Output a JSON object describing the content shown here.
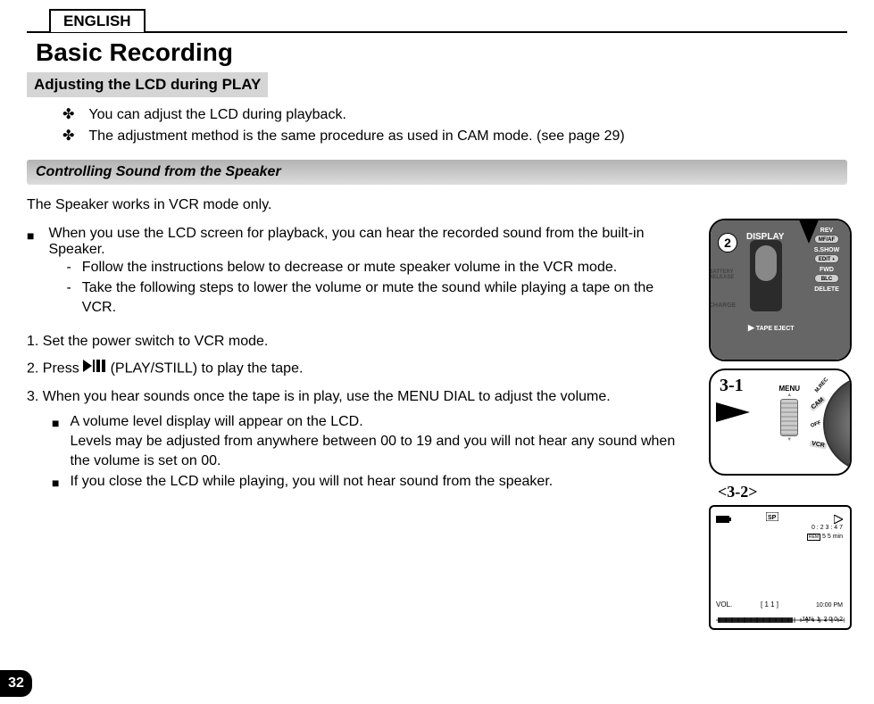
{
  "header": {
    "language_tab": "ENGLISH",
    "title": "Basic Recording"
  },
  "section1": {
    "title": "Adjusting the LCD during PLAY",
    "bullets": [
      "You can adjust the LCD during playback.",
      "The adjustment method is the same procedure as used in CAM mode. (see page 29)"
    ]
  },
  "section2": {
    "title": "Controlling Sound from the Speaker",
    "intro": "The Speaker works in VCR mode only.",
    "para_main": "When you use the LCD screen for playback, you can hear the recorded sound from the built-in Speaker.",
    "dash1": "Follow the instructions below to decrease or mute speaker volume in the VCR mode.",
    "dash2": "Take the following steps to lower the volume or mute the sound while playing a tape on the VCR.",
    "step1": "1.  Set the power switch to VCR mode.",
    "step2_prefix": "2.  Press ",
    "step2_suffix": "(PLAY/STILL) to play the tape.",
    "step3": "3.  When you hear sounds once the tape is in play, use the MENU DIAL to adjust the volume.",
    "nested1a": "A volume level display will appear on the LCD.",
    "nested1b": "Levels may be adjusted from anywhere between 00 to 19 and you will not hear any sound when the volume is set on 00.",
    "nested2": "If you close the LCD while playing, you will not hear sound from the speaker."
  },
  "diagram": {
    "step2_label": "2",
    "step31_label": "3-1",
    "step32_label": "<3-2>",
    "panel1": {
      "display": "DISPLAY",
      "battery_release": "BATTERY RELEASE",
      "charge": "CHARGE",
      "tape_eject": "TAPE EJECT",
      "rev": "REV",
      "mfaf": "MF/AF",
      "sshow": "S.SHOW",
      "edit": "EDIT",
      "fwd": "FWD",
      "blc": "BLC",
      "delete": "DELETE"
    },
    "panel2": {
      "menu": "MENU",
      "mrec": "M.REC",
      "cam": "CAM",
      "off": "OFF",
      "vcr": "VCR"
    },
    "screen": {
      "timecode": "0 : 2 3 : 4 7",
      "remaining": "5 5 min",
      "rem_label": "REM",
      "vol": "VOL.",
      "vol_value": "[ 1 1 ]",
      "time": "10:00 PM",
      "date": "JAN. 1, 2 0 0 2"
    }
  },
  "page_number": "32"
}
